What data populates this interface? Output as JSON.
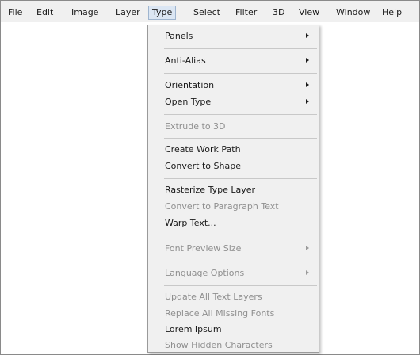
{
  "menubar": {
    "items": [
      "File",
      "Edit",
      "Image",
      "Layer",
      "Type",
      "Select",
      "Filter",
      "3D",
      "View",
      "Window",
      "Help"
    ],
    "open_item": "Type"
  },
  "type_menu": {
    "items": [
      {
        "label": "Panels",
        "enabled": true,
        "submenu": true
      },
      {
        "label": "Anti-Alias",
        "enabled": true,
        "submenu": true
      },
      {
        "label": "Orientation",
        "enabled": true,
        "submenu": true
      },
      {
        "label": "Open Type",
        "enabled": true,
        "submenu": true
      },
      {
        "label": "Extrude to 3D",
        "enabled": false,
        "submenu": false
      },
      {
        "label": "Create Work Path",
        "enabled": true,
        "submenu": false
      },
      {
        "label": "Convert to Shape",
        "enabled": true,
        "submenu": false
      },
      {
        "label": "Rasterize Type Layer",
        "enabled": true,
        "submenu": false
      },
      {
        "label": "Convert to Paragraph Text",
        "enabled": false,
        "submenu": false
      },
      {
        "label": "Warp Text...",
        "enabled": true,
        "submenu": false
      },
      {
        "label": "Font Preview Size",
        "enabled": false,
        "submenu": true
      },
      {
        "label": "Language Options",
        "enabled": false,
        "submenu": true
      },
      {
        "label": "Update All Text Layers",
        "enabled": false,
        "submenu": false
      },
      {
        "label": "Replace All Missing Fonts",
        "enabled": false,
        "submenu": false
      },
      {
        "label": "Lorem Ipsum",
        "enabled": true,
        "submenu": false
      },
      {
        "label": "Show Hidden Characters",
        "enabled": false,
        "submenu": false
      }
    ]
  },
  "colors": {
    "menubar_bg": "#f0f0f0",
    "open_highlight": "#dbe6f3",
    "disabled_text": "#8f8f8f"
  }
}
